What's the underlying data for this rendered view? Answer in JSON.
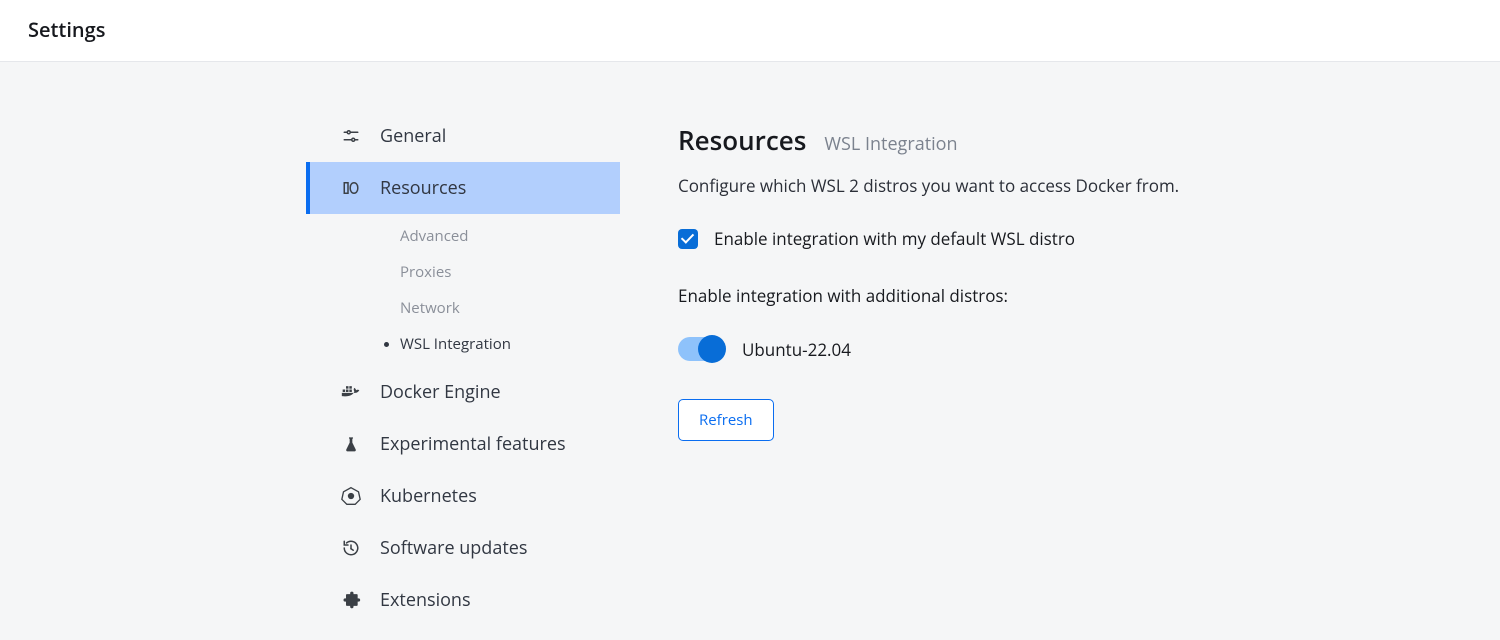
{
  "header": {
    "title": "Settings"
  },
  "sidebar": {
    "items": [
      {
        "label": "General"
      },
      {
        "label": "Resources",
        "sub": [
          {
            "label": "Advanced"
          },
          {
            "label": "Proxies"
          },
          {
            "label": "Network"
          },
          {
            "label": "WSL Integration"
          }
        ]
      },
      {
        "label": "Docker Engine"
      },
      {
        "label": "Experimental features"
      },
      {
        "label": "Kubernetes"
      },
      {
        "label": "Software updates"
      },
      {
        "label": "Extensions"
      }
    ]
  },
  "main": {
    "breadcrumb_title": "Resources",
    "breadcrumb_sub": "WSL Integration",
    "description": "Configure which WSL 2 distros you want to access Docker from.",
    "enable_default_label": "Enable integration with my default WSL distro",
    "enable_default_checked": true,
    "additional_label": "Enable integration with additional distros:",
    "distros": [
      {
        "name": "Ubuntu-22.04",
        "enabled": true
      }
    ],
    "refresh_label": "Refresh"
  }
}
